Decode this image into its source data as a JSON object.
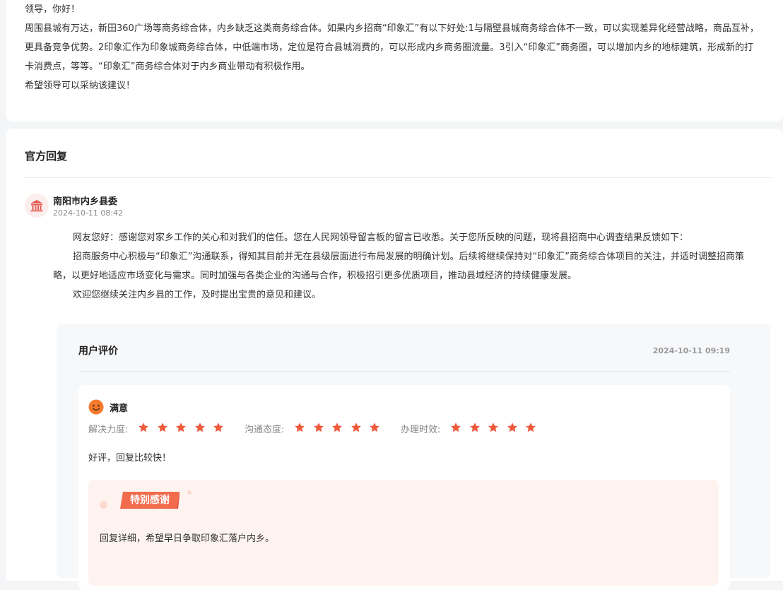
{
  "message": {
    "greeting": "领导，你好！",
    "line1": "周围县城有万达，新田360广场等商务综合体，内乡缺乏这类商务综合体。如果内乡招商“印象汇”有以下好处:1与隔壁县城商务综合体不一致，可以实现差异化经营战略，商品互补，",
    "line2": "更具备竞争优势。2印象汇作为印象城商务综合体，中低端市场，定位是符合县城消费的，可以形成内乡商务圈流量。3引入“印象汇”商务圈，可以增加内乡的地标建筑，形成新的打",
    "line3": "卡消费点，等等。“印象汇”商务综合体对于内乡商业带动有积极作用。",
    "closing": "希望领导可以采纳该建议！"
  },
  "reply": {
    "section_title": "官方回复",
    "department": "南阳市内乡县委",
    "time": "2024-10-11 08:42",
    "p1": "网友您好：感谢您对家乡工作的关心和对我们的信任。您在人民网领导留言板的留言已收悉。关于您所反映的问题，现将县招商中心调查结果反馈如下：",
    "p2a": "招商服务中心积极与“印象汇”沟通联系，得知其目前并无在县级层面进行布局发展的明确计划。后续将继续保持对“印象汇”商务综合体项目的关注，并适时调整招商策",
    "p2b": "略，以更好地适应市场变化与需求。同时加强与各类企业的沟通与合作，积极招引更多优质项目，推动县域经济的持续健康发展。",
    "p3": "欢迎您继续关注内乡县的工作，及时提出宝贵的意见和建议。"
  },
  "evaluation": {
    "title": "用户评价",
    "time": "2024-10-11 09:19",
    "satisfaction": "满意",
    "ratings": [
      {
        "label": "解决力度:",
        "stars": 5
      },
      {
        "label": "沟通态度:",
        "stars": 5
      },
      {
        "label": "办理时效:",
        "stars": 5
      }
    ],
    "comment": "好评，回复比较快！",
    "thanks_badge": "特别感谢",
    "thanks_text": "回复详细，希望早日争取印象汇落户内乡。"
  },
  "colors": {
    "star": "#ee5a3c",
    "badge": "#f26b4d",
    "smile": "#f47a2d",
    "avatar_icon": "#e45a52"
  },
  "icons": {
    "avatar": "government-building-icon",
    "satisfaction": "smile-face-icon",
    "rating": "star-icon"
  }
}
